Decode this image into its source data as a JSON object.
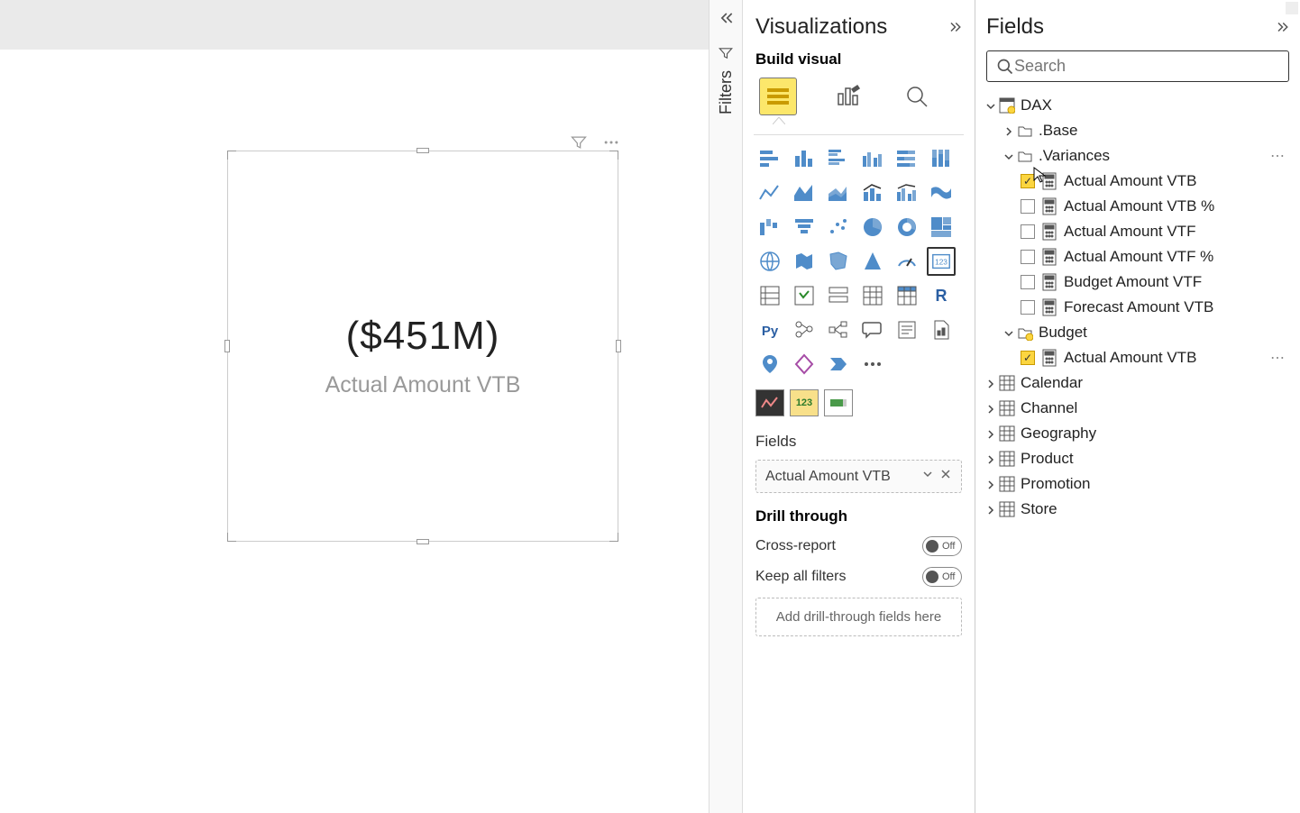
{
  "canvas": {
    "card_value": "($451M)",
    "card_label": "Actual Amount VTB"
  },
  "filters": {
    "label": "Filters"
  },
  "viz_pane": {
    "title": "Visualizations",
    "build_label": "Build visual",
    "fields_section": "Fields",
    "field_well_value": "Actual Amount VTB",
    "drill_label": "Drill through",
    "cross_report": "Cross-report",
    "keep_filters": "Keep all filters",
    "toggle_off": "Off",
    "drop_hint": "Add drill-through fields here"
  },
  "fields_pane": {
    "title": "Fields",
    "search_placeholder": "Search",
    "tree": {
      "dax": "DAX",
      "base": ".Base",
      "variances": ".Variances",
      "var_items": [
        "Actual Amount VTB",
        "Actual Amount VTB %",
        "Actual Amount VTF",
        "Actual Amount VTF %",
        "Budget Amount VTF",
        "Forecast Amount VTB"
      ],
      "budget": "Budget",
      "budget_item": "Actual Amount VTB",
      "calendar": "Calendar",
      "channel": "Channel",
      "geography": "Geography",
      "product": "Product",
      "promotion": "Promotion",
      "store": "Store"
    }
  }
}
